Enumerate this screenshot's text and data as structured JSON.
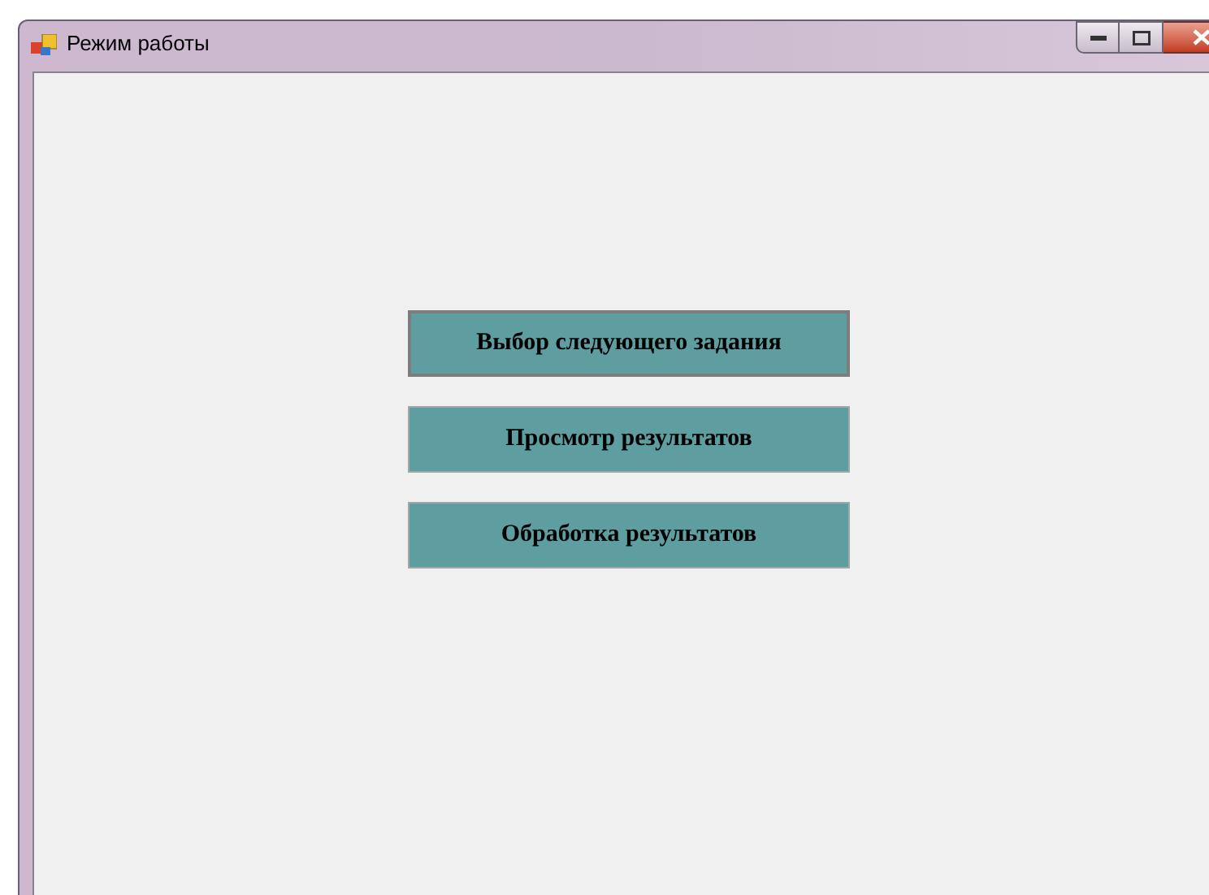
{
  "window": {
    "title": "Режим работы"
  },
  "buttons": [
    {
      "label": "Выбор следующего задания",
      "focused": true
    },
    {
      "label": "Просмотр результатов",
      "focused": false
    },
    {
      "label": "Обработка результатов",
      "focused": false
    }
  ]
}
